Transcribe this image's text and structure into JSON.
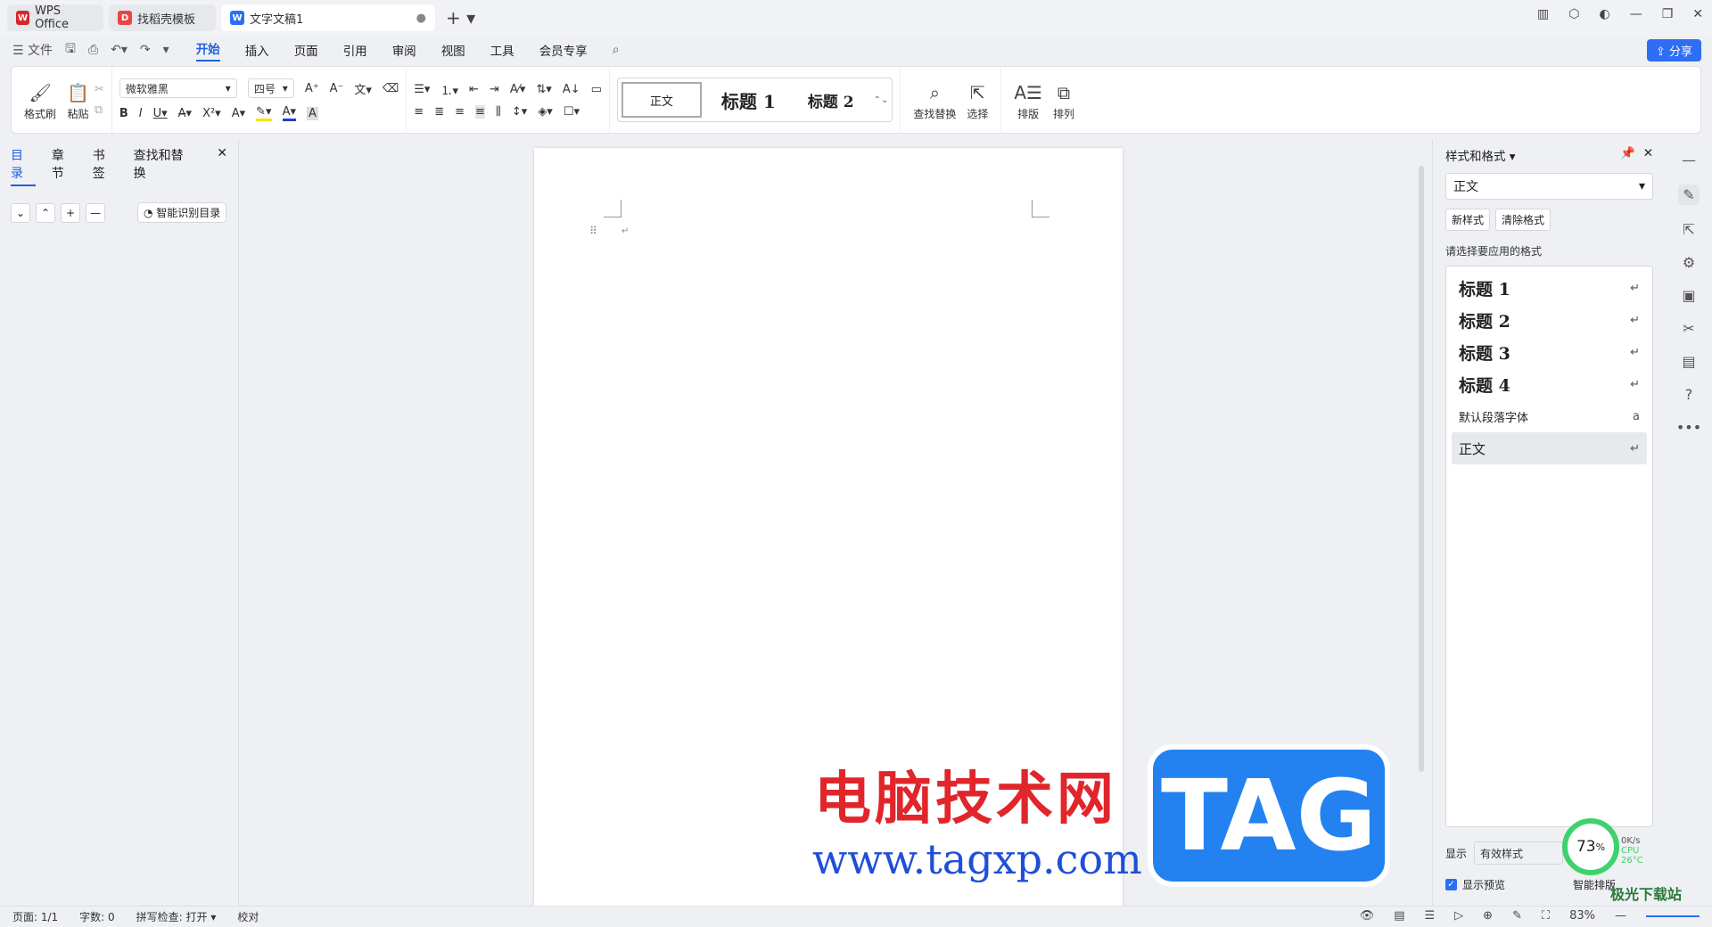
{
  "tabs": [
    {
      "label": "WPS Office",
      "icon": "wps-logo-icon",
      "color": "#d7262c"
    },
    {
      "label": "找稻壳模板",
      "icon": "docer-icon",
      "color": "#e84545"
    },
    {
      "label": "文字文稿1",
      "icon": "word-doc-icon",
      "color": "#2d6ef5"
    }
  ],
  "menu": {
    "file": "文件",
    "items": [
      "开始",
      "插入",
      "页面",
      "引用",
      "审阅",
      "视图",
      "工具",
      "会员专享"
    ],
    "active": "开始"
  },
  "share_label": "分享",
  "ribbon": {
    "format_painter": "格式刷",
    "paste": "粘贴",
    "font_name": "微软雅黑",
    "font_size": "四号",
    "styles": [
      "正文",
      "标题 1",
      "标题 2"
    ],
    "find_replace": "查找替换",
    "select": "选择",
    "layout": "排版",
    "arrange": "排列"
  },
  "left_pane": {
    "tabs": [
      "目录",
      "章节",
      "书签",
      "查找和替换"
    ],
    "active": "目录",
    "smart_toc": "智能识别目录"
  },
  "right_pane": {
    "title": "样式和格式",
    "current_style": "正文",
    "new_style": "新样式",
    "clear_format": "清除格式",
    "apply_label": "请选择要应用的格式",
    "styles": [
      {
        "name": "标题 1",
        "kind": "heading",
        "mark": "↵"
      },
      {
        "name": "标题 2",
        "kind": "heading",
        "mark": "↵"
      },
      {
        "name": "标题 3",
        "kind": "heading",
        "mark": "↵"
      },
      {
        "name": "标题 4",
        "kind": "heading",
        "mark": "↵"
      },
      {
        "name": "默认段落字体",
        "kind": "small",
        "mark": "a"
      },
      {
        "name": "正文",
        "kind": "body",
        "mark": "↵"
      }
    ],
    "show_label": "显示",
    "show_value": "有效样式",
    "preview_label": "显示预览",
    "smart_layout": "智能排版"
  },
  "status": {
    "page": "页面: 1/1",
    "words": "字数: 0",
    "spellcheck": "拼写检查: 打开",
    "proof": "校对",
    "zoom": "83%"
  },
  "watermark": {
    "cn": "电脑技术网",
    "url": "www.tagxp.com",
    "tag": "TAG"
  },
  "cpu_widget": {
    "percent": "73",
    "unit": "%",
    "speed": "0K/s",
    "cpu": "CPU 26°C"
  },
  "corner_brand": "极光下载站"
}
